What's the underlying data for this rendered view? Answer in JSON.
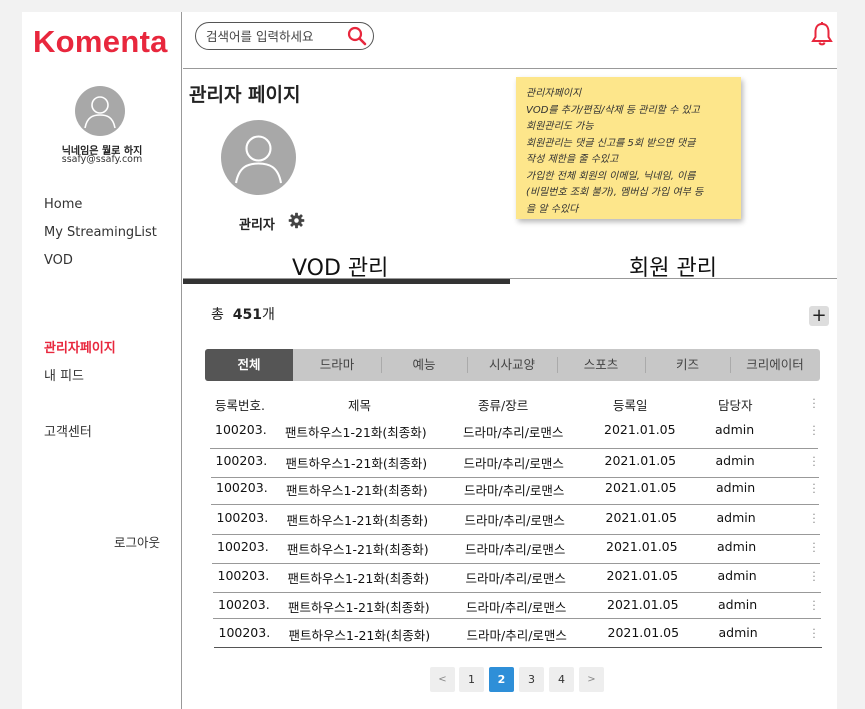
{
  "app": {
    "logo": "Komenta"
  },
  "sidebar": {
    "nickname": "닉네임은 뭘로 하지",
    "email": "ssafy@ssafy.com",
    "items": [
      {
        "label": "Home"
      },
      {
        "label": "My StreamingList"
      },
      {
        "label": "VOD"
      },
      {
        "label": "관리자페이지",
        "active": true
      },
      {
        "label": "내 피드"
      },
      {
        "label": "고객센터"
      }
    ],
    "logout": "로그아웃"
  },
  "search": {
    "placeholder": "검색어를 입력하세요"
  },
  "main": {
    "title": "관리자 페이지",
    "admin_name": "관리자",
    "tabs": [
      {
        "label": "VOD 관리",
        "active": true
      },
      {
        "label": "회원 관리"
      }
    ],
    "total_prefix": "총",
    "total_count": "451",
    "total_suffix": "개",
    "add_label": "+",
    "categories": [
      {
        "label": "전체",
        "active": true
      },
      {
        "label": "드라마"
      },
      {
        "label": "예능"
      },
      {
        "label": "시사교양"
      },
      {
        "label": "스포츠"
      },
      {
        "label": "키즈"
      },
      {
        "label": "크리에이터"
      }
    ],
    "columns": [
      "등록번호.",
      "제목",
      "종류/장르",
      "등록일",
      "담당자"
    ],
    "rows": [
      [
        "100203.",
        "팬트하우스1-21화(최종화)",
        "드라마/추리/로맨스",
        "2021.01.05",
        "admin"
      ],
      [
        "100203.",
        "팬트하우스1-21화(최종화)",
        "드라마/추리/로맨스",
        "2021.01.05",
        "admin"
      ],
      [
        "100203.",
        "팬트하우스1-21화(최종화)",
        "드라마/추리/로맨스",
        "2021.01.05",
        "admin"
      ],
      [
        "100203.",
        "팬트하우스1-21화(최종화)",
        "드라마/추리/로맨스",
        "2021.01.05",
        "admin"
      ],
      [
        "100203.",
        "팬트하우스1-21화(최종화)",
        "드라마/추리/로맨스",
        "2021.01.05",
        "admin"
      ],
      [
        "100203.",
        "팬트하우스1-21화(최종화)",
        "드라마/추리/로맨스",
        "2021.01.05",
        "admin"
      ],
      [
        "100203.",
        "팬트하우스1-21화(최종화)",
        "드라마/추리/로맨스",
        "2021.01.05",
        "admin"
      ],
      [
        "100203.",
        "팬트하우스1-21화(최종화)",
        "드라마/추리/로맨스",
        "2021.01.05",
        "admin"
      ]
    ],
    "pagination": {
      "prev": "<",
      "pages": [
        "1",
        "2",
        "3",
        "4"
      ],
      "current": "2",
      "next": ">"
    }
  },
  "note": {
    "lines": [
      "관리자페이지",
      "VOD를 추가/편집/삭제 등 관리할 수 있고",
      "회원관리도 가능",
      "회원관리는 댓글 신고를 5회 받으면 댓글",
      "작성 제한을 줄 수있고",
      "가입한 전체 회원의 이메일, 닉네임, 이름",
      "(비밀번호 조회 불가), 멤버십 가입 여부 등",
      "을 알 수있다"
    ]
  },
  "colors": {
    "brand": "#e8273d",
    "page_active": "#2e8fd8",
    "note": "#fde68b",
    "tab_active": "#555555"
  },
  "icons": [
    "search-icon",
    "bell-icon",
    "gear-icon",
    "kebab-icon",
    "avatar-icon"
  ]
}
